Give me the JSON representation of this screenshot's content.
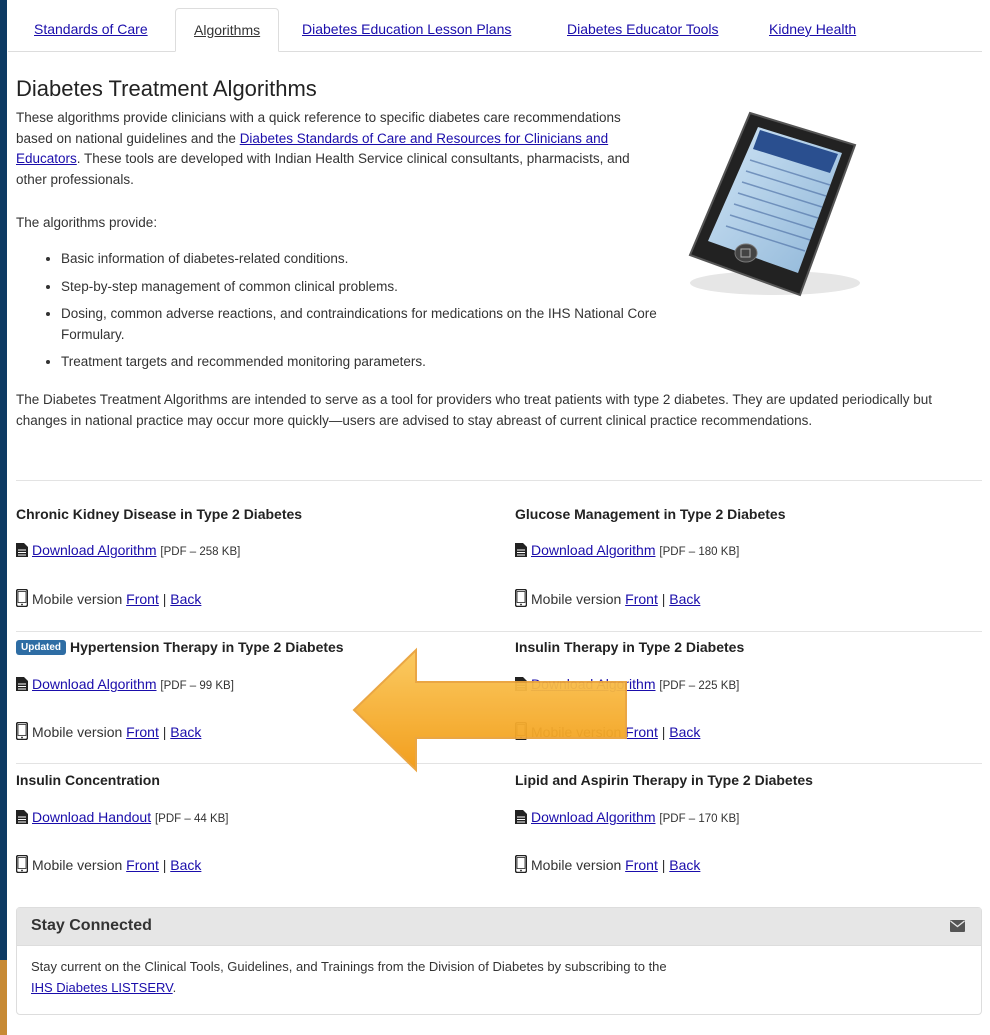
{
  "tabs": [
    {
      "label": "Standards of Care",
      "active": false
    },
    {
      "label": "Algorithms",
      "active": true
    },
    {
      "label": "Diabetes Education Lesson Plans",
      "active": false
    },
    {
      "label": "Diabetes Educator Tools",
      "active": false
    },
    {
      "label": "Kidney Health",
      "active": false
    }
  ],
  "page": {
    "title": "Diabetes Treatment Algorithms",
    "intro_before": "These algorithms provide clinicians with a quick reference to specific diabetes care recommendations based on national guidelines and the ",
    "intro_link": "Diabetes Standards of Care and Resources for Clinicians and Educators",
    "intro_after": ". These tools are developed with Indian Health Service clinical consultants, pharmacists, and other professionals.",
    "provide_label": "The algorithms provide:",
    "bullets": [
      "Basic information of diabetes-related conditions.",
      "Step-by-step management of common clinical problems.",
      "Dosing, common adverse reactions, and contraindications for medications on the IHS National Core Formulary.",
      "Treatment targets and recommended monitoring parameters."
    ],
    "description": "The Diabetes Treatment Algorithms are intended to serve as a tool for providers who treat patients with type 2 diabetes. They are updated periodically but changes in national practice may occur more quickly—users are advised to stay abreast of current clinical practice recommendations."
  },
  "cards": [
    {
      "title": "Chronic Kidney Disease in Type 2 Diabetes",
      "badge": "",
      "download_label": "Download Algorithm",
      "size": "[PDF – 258 KB]"
    },
    {
      "title": "Glucose Management in Type 2 Diabetes",
      "badge": "",
      "download_label": "Download Algorithm",
      "size": "[PDF – 180 KB]"
    },
    {
      "title": "Hypertension Therapy in Type 2 Diabetes",
      "badge": "Updated",
      "download_label": "Download Algorithm",
      "size": "[PDF – 99 KB]"
    },
    {
      "title": "Insulin Therapy in Type 2 Diabetes",
      "badge": "",
      "download_label": "Download Algorithm",
      "size": "[PDF – 225 KB]"
    },
    {
      "title": "Insulin Concentration",
      "badge": "",
      "download_label": "Download Handout",
      "size": "[PDF – 44 KB]"
    },
    {
      "title": "Lipid and Aspirin Therapy in Type 2 Diabetes",
      "badge": "",
      "download_label": "Download Algorithm",
      "size": "[PDF – 170 KB]"
    }
  ],
  "mobile": {
    "label": "Mobile version",
    "front": "Front",
    "sep": "|",
    "back": "Back"
  },
  "panel": {
    "title": "Stay Connected",
    "body": "Stay current on the Clinical Tools, Guidelines, and Trainings from the Division of Diabetes by subscribing to the",
    "link": "IHS Diabetes LISTSERV",
    "after_link": "."
  },
  "icons": {
    "download": "file-text-icon",
    "mobile": "mobile-phone-icon",
    "panel": "envelope-icon",
    "arrow": "left-arrow-icon"
  },
  "colors": {
    "link": "#1a0dab",
    "badge": "#2e6da4",
    "arrow": "#f7a520",
    "border": "#0d3a63"
  }
}
